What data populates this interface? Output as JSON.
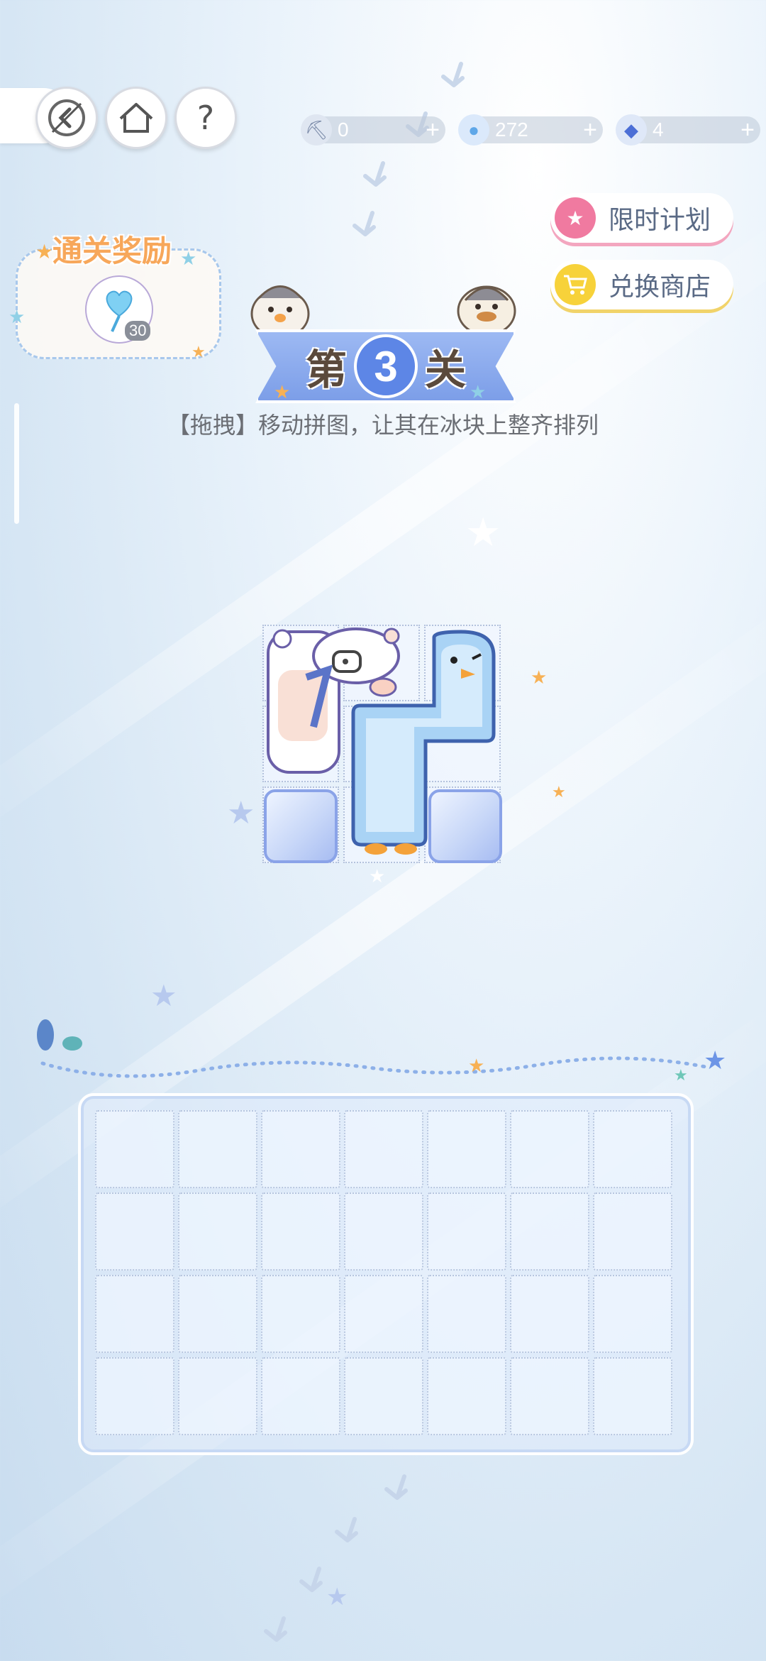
{
  "topbar": {
    "back_icon": "back-arrow-icon",
    "home_icon": "home-icon",
    "help_label": "?"
  },
  "resources": [
    {
      "name": "shovel",
      "icon": "shovel-icon",
      "value": "0"
    },
    {
      "name": "lollipop",
      "icon": "lollipop-icon",
      "value": "272"
    },
    {
      "name": "gem",
      "icon": "gem-icon",
      "value": "4"
    }
  ],
  "resource_plus": "+",
  "side_buttons": {
    "limited_plan": "限时计划",
    "exchange_shop": "兑换商店"
  },
  "reward": {
    "title": "通关奖励",
    "count": "30",
    "icon": "heart-lollipop-icon"
  },
  "level": {
    "prefix": "第",
    "number": "3",
    "suffix": "关"
  },
  "hint": "【拖拽】移动拼图，让其在冰块上整齐排列",
  "colors": {
    "accent_blue": "#5d86e6",
    "pink": "#f07aa0",
    "yellow": "#f7d23a"
  }
}
